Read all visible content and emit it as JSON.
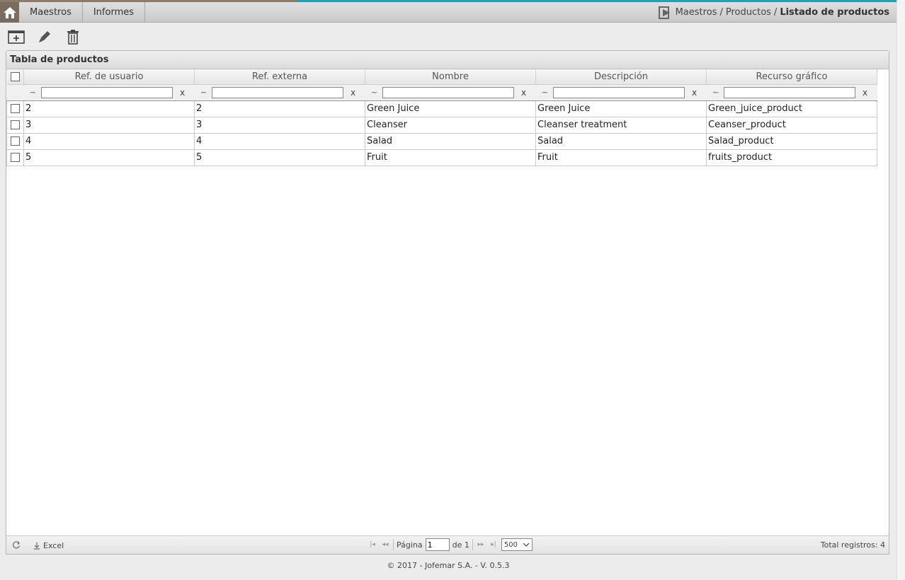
{
  "nav": {
    "menu": [
      "Maestros",
      "Informes"
    ],
    "breadcrumb": {
      "part1": "Maestros",
      "sep": "/",
      "part2": "Productos",
      "current": "Listado de productos"
    }
  },
  "toolbar": {
    "icons": [
      "new-window-icon",
      "edit-icon",
      "trash-icon"
    ]
  },
  "table": {
    "title": "Tabla de productos",
    "columns": [
      "Ref. de usuario",
      "Ref. externa",
      "Nombre",
      "Descripción",
      "Recurso gráfico"
    ],
    "filter": {
      "op": "~",
      "clear": "x"
    },
    "rows": [
      [
        "2",
        "2",
        "Green Juice",
        "Green Juice",
        "Green_juice_product"
      ],
      [
        "3",
        "3",
        "Cleanser",
        "Cleanser treatment",
        "Ceanser_product"
      ],
      [
        "4",
        "4",
        "Salad",
        "Salad",
        "Salad_product"
      ],
      [
        "5",
        "5",
        "Fruit",
        "Fruit",
        "fruits_product"
      ]
    ]
  },
  "footer": {
    "excel": "Excel",
    "page_label": "Página",
    "page_value": "1",
    "of_label": "de 1",
    "page_size": "500",
    "total": "Total registros: 4"
  },
  "copyright": "© 2017 - Jofemar S.A. - V. 0.5.3",
  "colors": {
    "accent": "#1aa3b5",
    "home": "#7b6c60"
  }
}
